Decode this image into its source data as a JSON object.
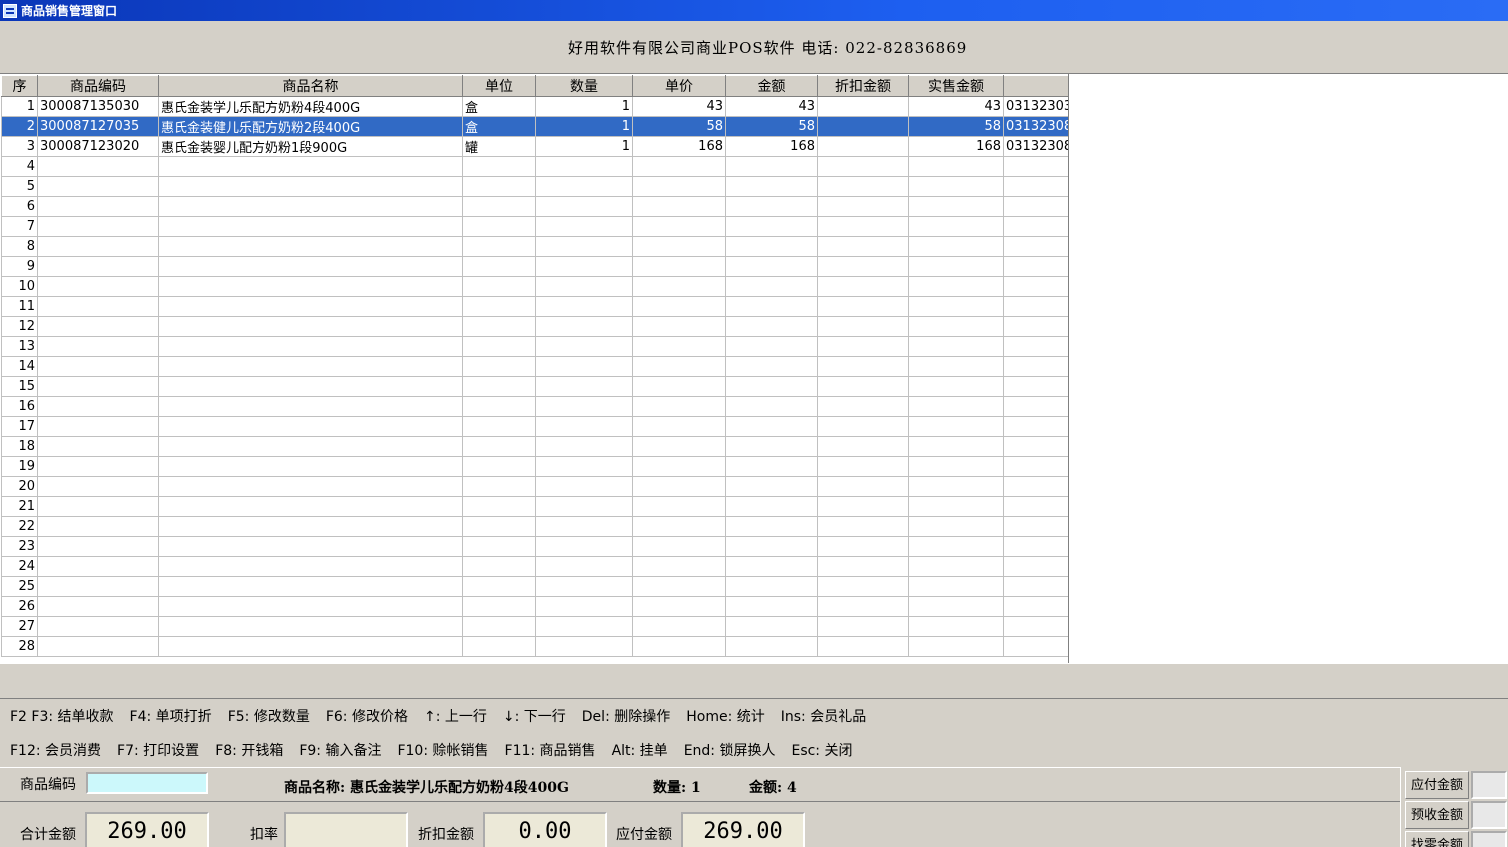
{
  "window": {
    "title": "商品销售管理窗口"
  },
  "header": {
    "company_line": "好用软件有限公司商业POS软件  电话: 022-82836869"
  },
  "grid": {
    "columns": [
      "序",
      "商品编码",
      "商品名称",
      "单位",
      "数量",
      "单价",
      "金额",
      "折扣金额",
      "实售金额",
      ""
    ],
    "rows": [
      {
        "seq": "1",
        "code": "300087135030",
        "name": "惠氏金装学儿乐配方奶粉4段400G",
        "unit": "盒",
        "qty": "1",
        "price": "43",
        "amount": "43",
        "discount": "",
        "actual": "43",
        "extra": "03132303"
      },
      {
        "seq": "2",
        "code": "300087127035",
        "name": "惠氏金装健儿乐配方奶粉2段400G",
        "unit": "盒",
        "qty": "1",
        "price": "58",
        "amount": "58",
        "discount": "",
        "actual": "58",
        "extra": "03132308"
      },
      {
        "seq": "3",
        "code": "300087123020",
        "name": "惠氏金装婴儿配方奶粉1段900G",
        "unit": "罐",
        "qty": "1",
        "price": "168",
        "amount": "168",
        "discount": "",
        "actual": "168",
        "extra": "03132308"
      }
    ],
    "selected_row": 2,
    "empty_row_numbers": [
      "4",
      "5",
      "6",
      "7",
      "8",
      "9",
      "10",
      "11",
      "12",
      "13",
      "14",
      "15",
      "16",
      "17",
      "18",
      "19",
      "20",
      "21",
      "22",
      "23",
      "24",
      "25",
      "26",
      "27",
      "28"
    ]
  },
  "hotkeys": {
    "line1": [
      "F2 F3: 结单收款",
      "F4: 单项打折",
      "F5: 修改数量",
      "F6: 修改价格",
      "↑: 上一行",
      "↓: 下一行",
      "Del: 删除操作",
      "Home: 统计",
      "Ins: 会员礼品"
    ],
    "line2": [
      "F12: 会员消费",
      "F7: 打印设置",
      "F8: 开钱箱",
      "F9: 输入备注",
      "F10: 赊帐销售",
      "F11: 商品销售",
      "Alt: 挂单",
      "End: 锁屏换人",
      "Esc: 关闭"
    ]
  },
  "entry": {
    "code_label": "商品编码",
    "code_value": "",
    "product_name": "商品名称: 惠氏金装学儿乐配方奶粉4段400G",
    "quantity": "数量: 1",
    "amount": "金额: 4"
  },
  "totals": {
    "total_label": "合计金额",
    "total_value": "269.00",
    "rate_label": "扣率",
    "rate_value": "",
    "discount_label": "折扣金额",
    "discount_value": "0.00",
    "payable_label": "应付金额",
    "payable_value": "269.00"
  },
  "side_panel": {
    "payable": "应付金额",
    "received": "预收金额",
    "change": "找零金额"
  },
  "colors": {
    "selection": "#316ac5",
    "code_input_bg": "#ccf8fb",
    "titlebar": "#0a36b8"
  }
}
